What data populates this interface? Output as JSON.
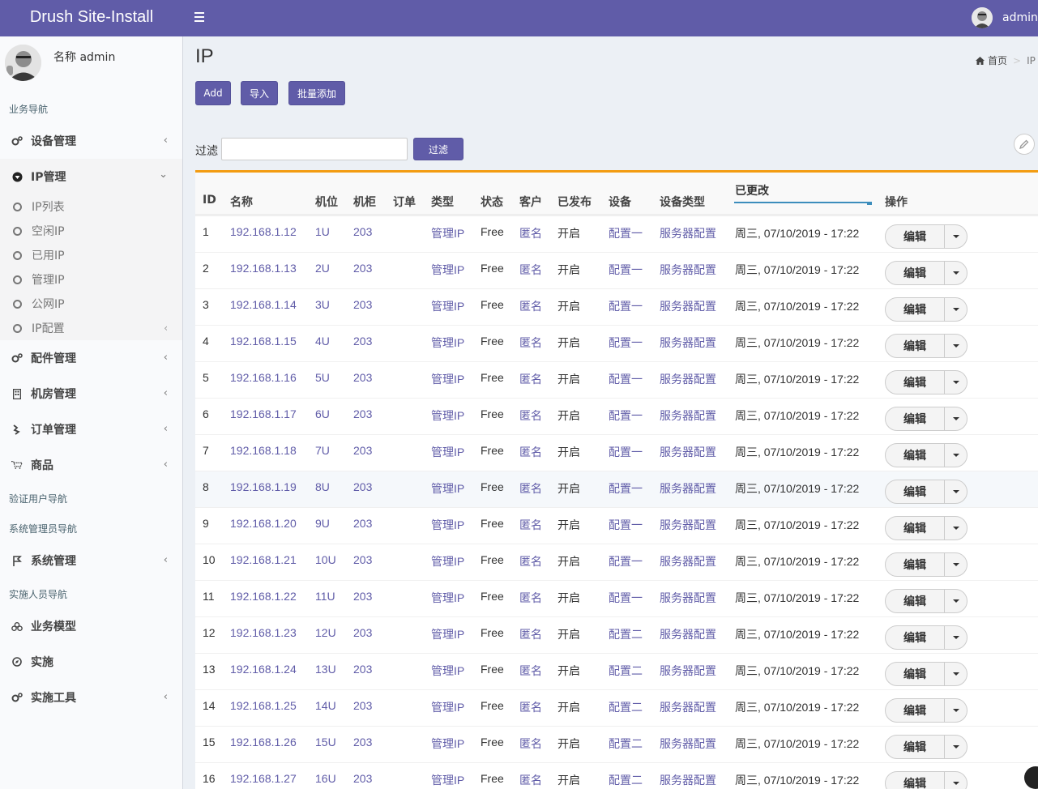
{
  "app": {
    "title": "Drush Site-Install",
    "user": "admin"
  },
  "sidebar": {
    "user_label": "名称 admin",
    "sections": {
      "business_nav": "业务导航",
      "verify_nav": "验证用户导航",
      "sysadmin_nav": "系统管理员导航",
      "implementer_nav": "实施人员导航"
    },
    "items": [
      {
        "label": "设备管理",
        "icon": "gears-icon"
      },
      {
        "label": "IP管理",
        "icon": "ip-shield-icon"
      },
      {
        "label": "配件管理",
        "icon": "gears-icon"
      },
      {
        "label": "机房管理",
        "icon": "building-icon"
      },
      {
        "label": "订单管理",
        "icon": "order-icon"
      },
      {
        "label": "商品",
        "icon": "cart-icon"
      },
      {
        "label": "系统管理",
        "icon": "flag-icon"
      },
      {
        "label": "业务模型",
        "icon": "cubes-icon"
      },
      {
        "label": "实施",
        "icon": "compass-icon"
      },
      {
        "label": "实施工具",
        "icon": "gears-icon"
      }
    ],
    "ip_sub": [
      "IP列表",
      "空闲IP",
      "已用IP",
      "管理IP",
      "公网IP",
      "IP配置"
    ]
  },
  "page": {
    "title": "IP",
    "breadcrumb": {
      "home": "首页",
      "current": "IP"
    },
    "buttons": {
      "add": "Add",
      "import": "导入",
      "batch_add": "批量添加"
    },
    "filter": {
      "label": "过滤",
      "value": "",
      "button": "过滤"
    }
  },
  "table": {
    "headers": {
      "id": "ID",
      "name": "名称",
      "position": "机位",
      "cabinet": "机柜",
      "order": "订单",
      "type": "类型",
      "status": "状态",
      "customer": "客户",
      "published": "已发布",
      "device": "设备",
      "device_type": "设备类型",
      "changed": "已更改",
      "actions": "操作"
    },
    "edit_label": "编辑",
    "rows": [
      {
        "id": "1",
        "name": "192.168.1.12",
        "position": "1U",
        "cabinet": "203",
        "order": "",
        "type": "管理IP",
        "status": "Free",
        "customer": "匿名",
        "published": "开启",
        "device": "配置一",
        "device_type": "服务器配置",
        "changed": "周三, 07/10/2019 - 17:22"
      },
      {
        "id": "2",
        "name": "192.168.1.13",
        "position": "2U",
        "cabinet": "203",
        "order": "",
        "type": "管理IP",
        "status": "Free",
        "customer": "匿名",
        "published": "开启",
        "device": "配置一",
        "device_type": "服务器配置",
        "changed": "周三, 07/10/2019 - 17:22"
      },
      {
        "id": "3",
        "name": "192.168.1.14",
        "position": "3U",
        "cabinet": "203",
        "order": "",
        "type": "管理IP",
        "status": "Free",
        "customer": "匿名",
        "published": "开启",
        "device": "配置一",
        "device_type": "服务器配置",
        "changed": "周三, 07/10/2019 - 17:22"
      },
      {
        "id": "4",
        "name": "192.168.1.15",
        "position": "4U",
        "cabinet": "203",
        "order": "",
        "type": "管理IP",
        "status": "Free",
        "customer": "匿名",
        "published": "开启",
        "device": "配置一",
        "device_type": "服务器配置",
        "changed": "周三, 07/10/2019 - 17:22"
      },
      {
        "id": "5",
        "name": "192.168.1.16",
        "position": "5U",
        "cabinet": "203",
        "order": "",
        "type": "管理IP",
        "status": "Free",
        "customer": "匿名",
        "published": "开启",
        "device": "配置一",
        "device_type": "服务器配置",
        "changed": "周三, 07/10/2019 - 17:22"
      },
      {
        "id": "6",
        "name": "192.168.1.17",
        "position": "6U",
        "cabinet": "203",
        "order": "",
        "type": "管理IP",
        "status": "Free",
        "customer": "匿名",
        "published": "开启",
        "device": "配置一",
        "device_type": "服务器配置",
        "changed": "周三, 07/10/2019 - 17:22"
      },
      {
        "id": "7",
        "name": "192.168.1.18",
        "position": "7U",
        "cabinet": "203",
        "order": "",
        "type": "管理IP",
        "status": "Free",
        "customer": "匿名",
        "published": "开启",
        "device": "配置一",
        "device_type": "服务器配置",
        "changed": "周三, 07/10/2019 - 17:22"
      },
      {
        "id": "8",
        "name": "192.168.1.19",
        "position": "8U",
        "cabinet": "203",
        "order": "",
        "type": "管理IP",
        "status": "Free",
        "customer": "匿名",
        "published": "开启",
        "device": "配置一",
        "device_type": "服务器配置",
        "changed": "周三, 07/10/2019 - 17:22"
      },
      {
        "id": "9",
        "name": "192.168.1.20",
        "position": "9U",
        "cabinet": "203",
        "order": "",
        "type": "管理IP",
        "status": "Free",
        "customer": "匿名",
        "published": "开启",
        "device": "配置一",
        "device_type": "服务器配置",
        "changed": "周三, 07/10/2019 - 17:22"
      },
      {
        "id": "10",
        "name": "192.168.1.21",
        "position": "10U",
        "cabinet": "203",
        "order": "",
        "type": "管理IP",
        "status": "Free",
        "customer": "匿名",
        "published": "开启",
        "device": "配置一",
        "device_type": "服务器配置",
        "changed": "周三, 07/10/2019 - 17:22"
      },
      {
        "id": "11",
        "name": "192.168.1.22",
        "position": "11U",
        "cabinet": "203",
        "order": "",
        "type": "管理IP",
        "status": "Free",
        "customer": "匿名",
        "published": "开启",
        "device": "配置一",
        "device_type": "服务器配置",
        "changed": "周三, 07/10/2019 - 17:22"
      },
      {
        "id": "12",
        "name": "192.168.1.23",
        "position": "12U",
        "cabinet": "203",
        "order": "",
        "type": "管理IP",
        "status": "Free",
        "customer": "匿名",
        "published": "开启",
        "device": "配置二",
        "device_type": "服务器配置",
        "changed": "周三, 07/10/2019 - 17:22"
      },
      {
        "id": "13",
        "name": "192.168.1.24",
        "position": "13U",
        "cabinet": "203",
        "order": "",
        "type": "管理IP",
        "status": "Free",
        "customer": "匿名",
        "published": "开启",
        "device": "配置二",
        "device_type": "服务器配置",
        "changed": "周三, 07/10/2019 - 17:22"
      },
      {
        "id": "14",
        "name": "192.168.1.25",
        "position": "14U",
        "cabinet": "203",
        "order": "",
        "type": "管理IP",
        "status": "Free",
        "customer": "匿名",
        "published": "开启",
        "device": "配置二",
        "device_type": "服务器配置",
        "changed": "周三, 07/10/2019 - 17:22"
      },
      {
        "id": "15",
        "name": "192.168.1.26",
        "position": "15U",
        "cabinet": "203",
        "order": "",
        "type": "管理IP",
        "status": "Free",
        "customer": "匿名",
        "published": "开启",
        "device": "配置二",
        "device_type": "服务器配置",
        "changed": "周三, 07/10/2019 - 17:22"
      },
      {
        "id": "16",
        "name": "192.168.1.27",
        "position": "16U",
        "cabinet": "203",
        "order": "",
        "type": "管理IP",
        "status": "Free",
        "customer": "匿名",
        "published": "开启",
        "device": "配置二",
        "device_type": "服务器配置",
        "changed": "周三, 07/10/2019 - 17:22"
      }
    ]
  },
  "colors": {
    "brand": "#605ca8",
    "accent_border": "#f39c12",
    "link": "#605ca8"
  }
}
